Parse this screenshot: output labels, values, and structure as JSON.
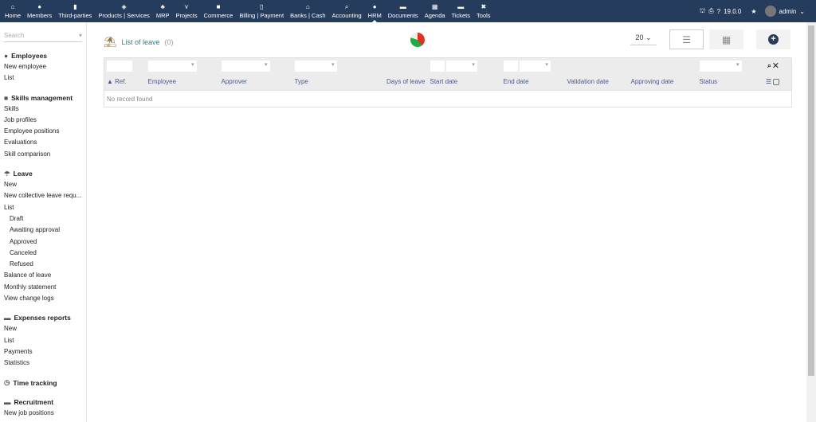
{
  "topnav": {
    "items": [
      {
        "label": "Home",
        "icon": "home-icon",
        "glyph": "⌂"
      },
      {
        "label": "Members",
        "icon": "user-icon",
        "glyph": "●"
      },
      {
        "label": "Third-parties",
        "icon": "building-icon",
        "glyph": "▮"
      },
      {
        "label": "Products | Services",
        "icon": "cube-icon",
        "glyph": "◈"
      },
      {
        "label": "MRP",
        "icon": "cubes-icon",
        "glyph": "♣"
      },
      {
        "label": "Projects",
        "icon": "project-icon",
        "glyph": "⋎"
      },
      {
        "label": "Commerce",
        "icon": "briefcase-icon",
        "glyph": "■"
      },
      {
        "label": "Billing | Payment",
        "icon": "invoice-icon",
        "glyph": "▯"
      },
      {
        "label": "Banks | Cash",
        "icon": "bank-icon",
        "glyph": "⌂"
      },
      {
        "label": "Accounting",
        "icon": "search-dollar-icon",
        "glyph": "⌕"
      },
      {
        "label": "HRM",
        "icon": "user-tie-icon",
        "glyph": "●"
      },
      {
        "label": "Documents",
        "icon": "folder-icon",
        "glyph": "▬"
      },
      {
        "label": "Agenda",
        "icon": "calendar-icon",
        "glyph": "▦"
      },
      {
        "label": "Tickets",
        "icon": "ticket-icon",
        "glyph": "▬"
      },
      {
        "label": "Tools",
        "icon": "tools-icon",
        "glyph": "✖"
      }
    ],
    "version": "19.0.0",
    "user": "admin"
  },
  "sidebar": {
    "search_placeholder": "Search",
    "groups": [
      {
        "title": "Employees",
        "glyph": "●",
        "items": [
          {
            "label": "New employee"
          },
          {
            "label": "List"
          }
        ]
      },
      {
        "title": "Skills management",
        "glyph": "■",
        "items": [
          {
            "label": "Skills"
          },
          {
            "label": "Job profiles"
          },
          {
            "label": "Employee positions"
          },
          {
            "label": "Evaluations"
          },
          {
            "label": "Skill comparison"
          }
        ]
      },
      {
        "title": "Leave",
        "glyph": "☂",
        "items": [
          {
            "label": "New"
          },
          {
            "label": "New collective leave requ..."
          },
          {
            "label": "List"
          },
          {
            "label": "Draft",
            "sub": true
          },
          {
            "label": "Awaiting approval",
            "sub": true
          },
          {
            "label": "Approved",
            "sub": true
          },
          {
            "label": "Canceled",
            "sub": true
          },
          {
            "label": "Refused",
            "sub": true
          },
          {
            "label": "Balance of leave"
          },
          {
            "label": "Monthly statement"
          },
          {
            "label": "View change logs"
          }
        ]
      },
      {
        "title": "Expenses reports",
        "glyph": "▬",
        "items": [
          {
            "label": "New"
          },
          {
            "label": "List"
          },
          {
            "label": "Payments"
          },
          {
            "label": "Statistics"
          }
        ]
      },
      {
        "title": "Time tracking",
        "glyph": "◷",
        "items": []
      },
      {
        "title": "Recruitment",
        "glyph": "▬",
        "items": [
          {
            "label": "New job positions"
          }
        ]
      }
    ]
  },
  "main": {
    "title": "List of leave",
    "count": "(0)",
    "per_page": "20",
    "columns": [
      "▲ Ref.",
      "Employee",
      "Approver",
      "Type",
      "Days of leave",
      "Start date",
      "End date",
      "Validation date",
      "Approving date",
      "Status"
    ],
    "empty": "No record found"
  }
}
